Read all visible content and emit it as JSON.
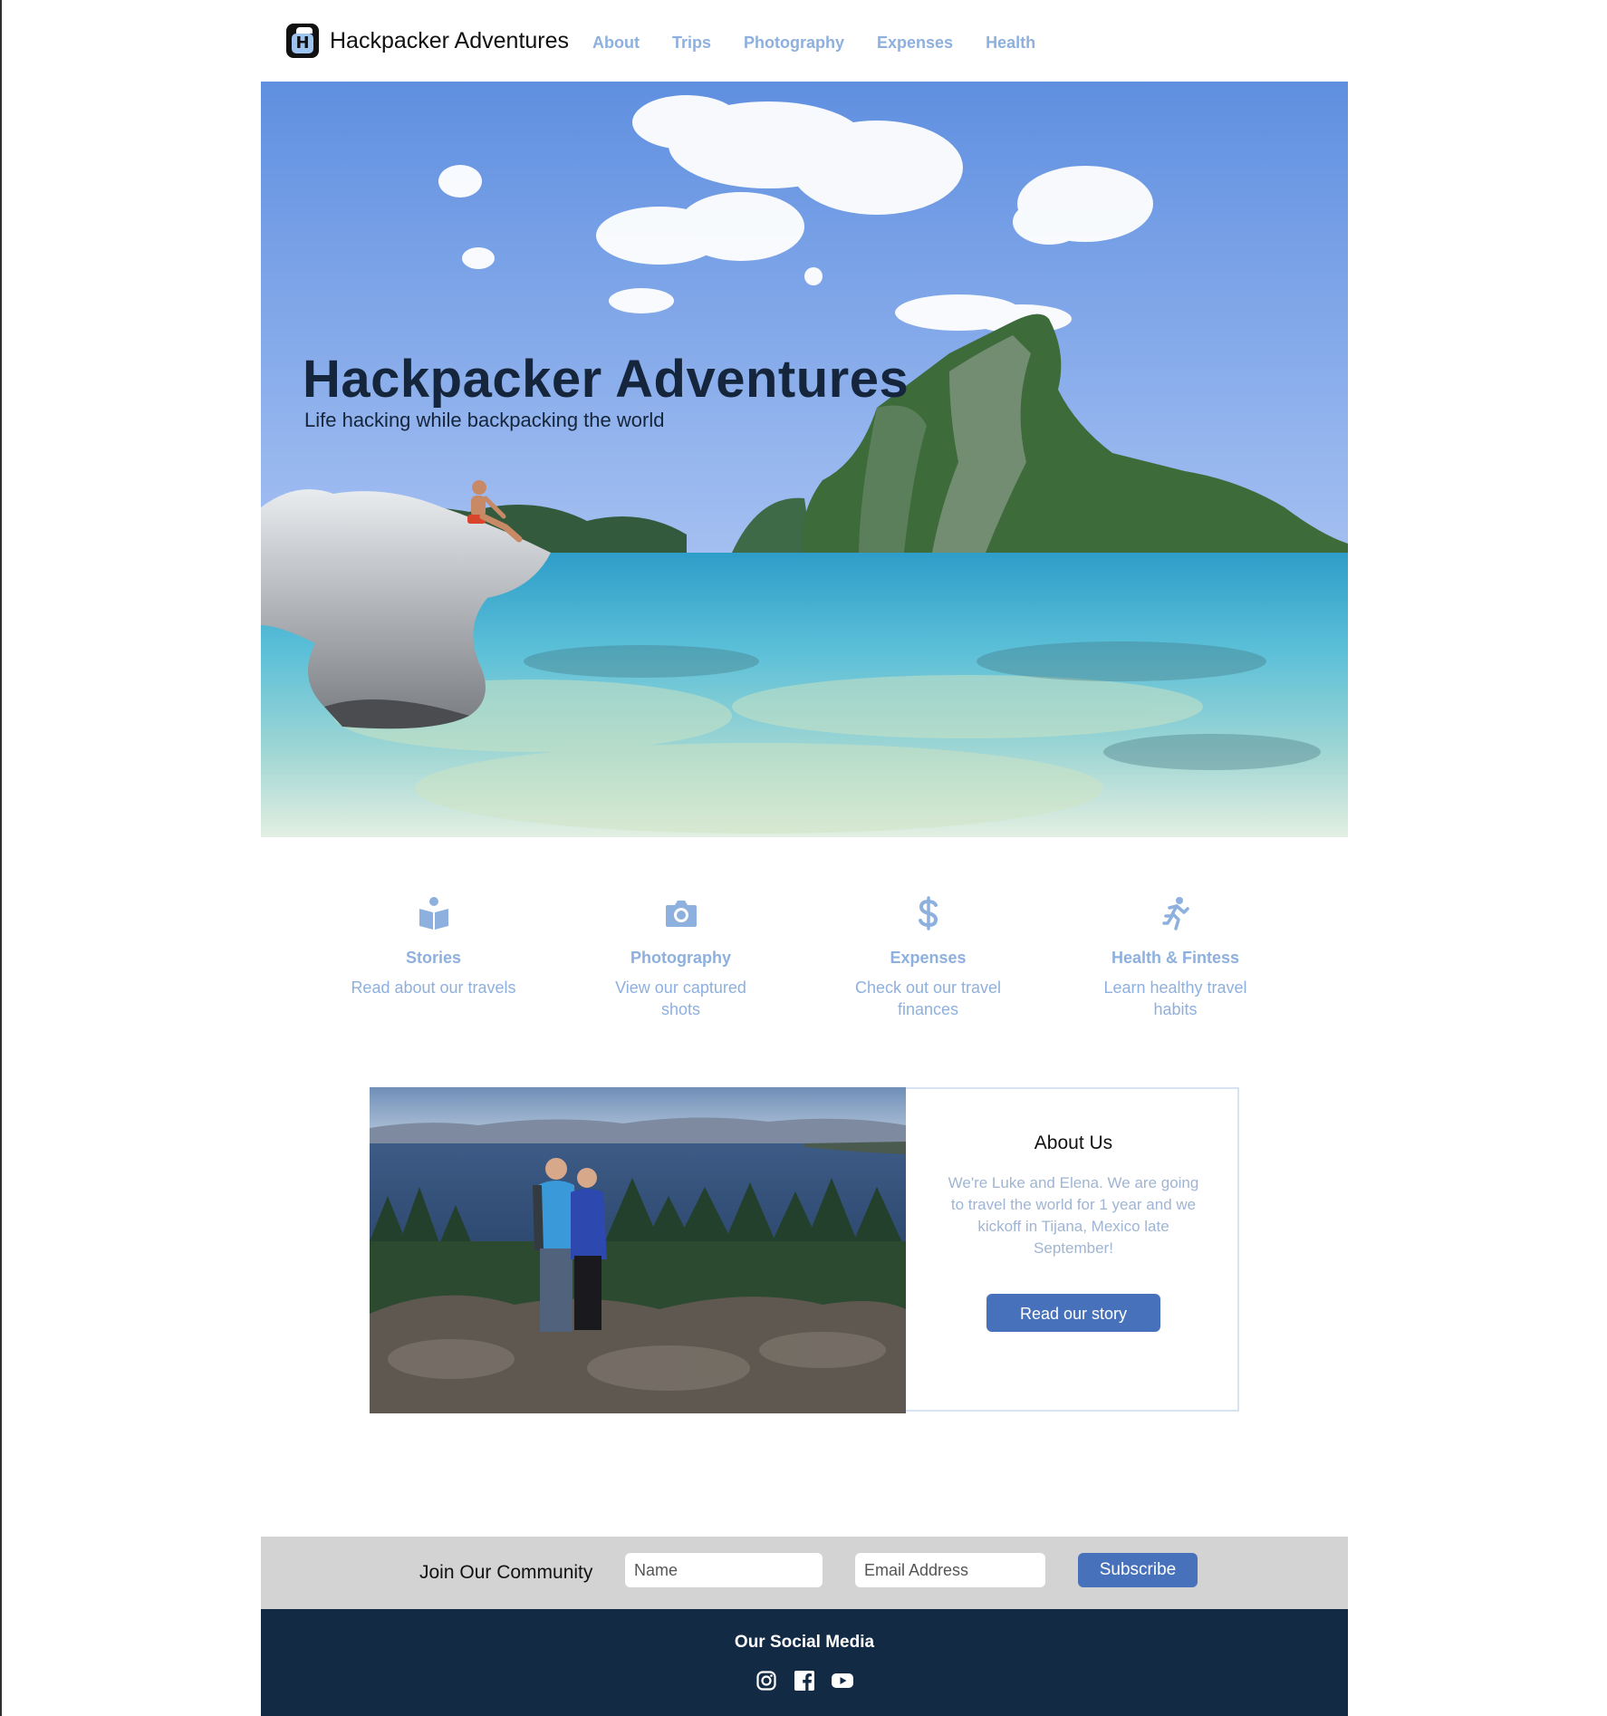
{
  "brand": {
    "name": "Hackpacker Adventures",
    "logo_letter": "H"
  },
  "nav": {
    "items": [
      {
        "label": "About"
      },
      {
        "label": "Trips"
      },
      {
        "label": "Photography"
      },
      {
        "label": "Expenses"
      },
      {
        "label": "Health"
      }
    ]
  },
  "hero": {
    "title": "Hackpacker Adventures",
    "subtitle": "Life hacking while backpacking the world"
  },
  "features": [
    {
      "icon": "book-icon",
      "title": "Stories",
      "desc": "Read about our travels"
    },
    {
      "icon": "camera-icon",
      "title": "Photography",
      "desc": "View our captured shots"
    },
    {
      "icon": "dollar-icon",
      "title": "Expenses",
      "desc": "Check out our travel finances"
    },
    {
      "icon": "running-icon",
      "title": "Health & Fintess",
      "desc": "Learn healthy travel habits"
    }
  ],
  "about": {
    "title": "About Us",
    "body": "We're Luke and Elena. We are going to travel the world for 1 year and we kickoff in Tijana, Mexico late September!",
    "button_label": "Read our story"
  },
  "subscribe": {
    "label": "Join Our Community",
    "name_placeholder": "Name",
    "email_placeholder": "Email Address",
    "button_label": "Subscribe"
  },
  "footer": {
    "title": "Our Social Media",
    "icons": [
      "instagram-icon",
      "facebook-icon",
      "youtube-icon"
    ]
  },
  "colors": {
    "accent": "#4772bb",
    "nav_link": "#8eb0de",
    "footer_bg": "#132a45",
    "subscribe_bg": "#d3d3d3"
  }
}
